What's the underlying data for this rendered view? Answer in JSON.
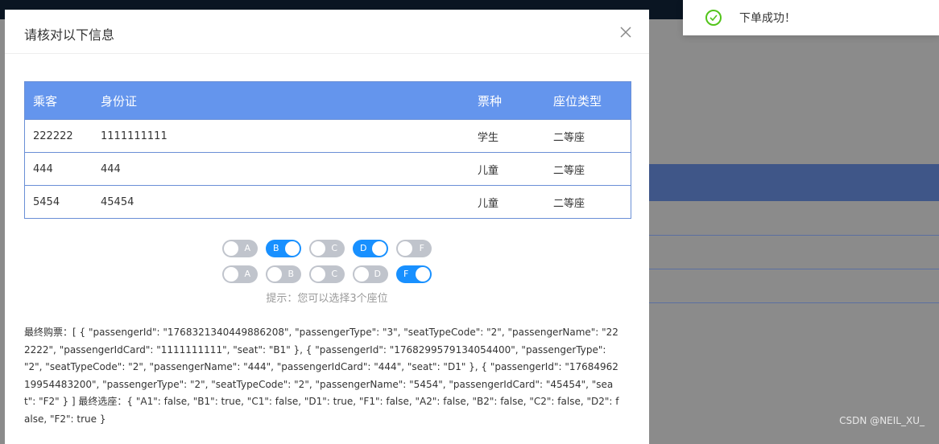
{
  "modal": {
    "title": "请核对以下信息",
    "close_icon": "close-icon"
  },
  "table": {
    "headers": [
      "乘客",
      "身份证",
      "票种",
      "座位类型"
    ],
    "rows": [
      [
        "222222",
        "1111111111",
        "学生",
        "二等座"
      ],
      [
        "444",
        "444",
        "儿童",
        "二等座"
      ],
      [
        "5454",
        "45454",
        "儿童",
        "二等座"
      ]
    ],
    "header_color": "#6495ed"
  },
  "seats": {
    "row1": [
      {
        "label": "A",
        "on": false
      },
      {
        "label": "B",
        "on": true
      },
      {
        "label": "C",
        "on": false
      },
      {
        "label": "D",
        "on": true
      },
      {
        "label": "F",
        "on": false
      }
    ],
    "row2": [
      {
        "label": "A",
        "on": false
      },
      {
        "label": "B",
        "on": false
      },
      {
        "label": "C",
        "on": false
      },
      {
        "label": "D",
        "on": false
      },
      {
        "label": "F",
        "on": true
      }
    ],
    "hint": "提示：您可以选择3个座位",
    "on_color": "#1890ff",
    "off_color": "#c0c4cc"
  },
  "final": {
    "text": "最终购票：[ { \"passengerId\": \"1768321340449886208\", \"passengerType\": \"3\", \"seatTypeCode\": \"2\", \"passengerName\": \"222222\", \"passengerIdCard\": \"1111111111\", \"seat\": \"B1\" }, { \"passengerId\": \"1768299579134054400\", \"passengerType\": \"2\", \"seatTypeCode\": \"2\", \"passengerName\": \"444\", \"passengerIdCard\": \"444\", \"seat\": \"D1\" }, { \"passengerId\": \"1768496219954483200\", \"passengerType\": \"2\", \"seatTypeCode\": \"2\", \"passengerName\": \"5454\", \"passengerIdCard\": \"45454\", \"seat\": \"F2\" } ] 最终选座：{ \"A1\": false, \"B1\": true, \"C1\": false, \"D1\": true, \"F1\": false, \"A2\": false, \"B2\": false, \"C2\": false, \"D2\": false, \"F2\": true }"
  },
  "toast": {
    "message": "下单成功！",
    "icon": "check-circle-icon",
    "color": "#52c41a"
  },
  "watermark": "CSDN @NEIL_XU_"
}
